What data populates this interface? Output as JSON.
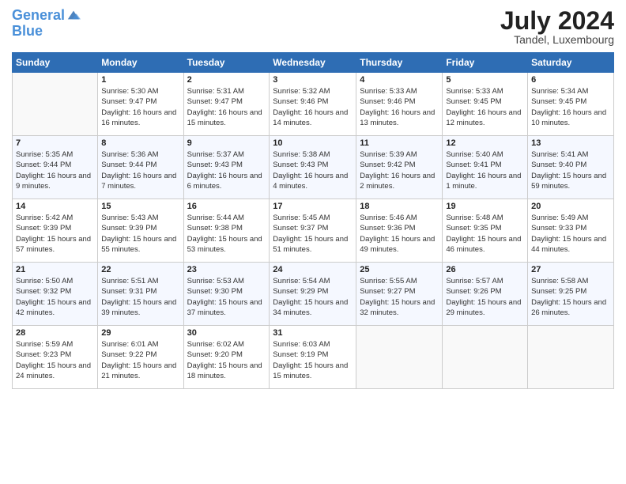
{
  "header": {
    "logo_line1": "General",
    "logo_line2": "Blue",
    "month": "July 2024",
    "location": "Tandel, Luxembourg"
  },
  "weekdays": [
    "Sunday",
    "Monday",
    "Tuesday",
    "Wednesday",
    "Thursday",
    "Friday",
    "Saturday"
  ],
  "weeks": [
    [
      {
        "day": "",
        "sunrise": "",
        "sunset": "",
        "daylight": ""
      },
      {
        "day": "1",
        "sunrise": "Sunrise: 5:30 AM",
        "sunset": "Sunset: 9:47 PM",
        "daylight": "Daylight: 16 hours and 16 minutes."
      },
      {
        "day": "2",
        "sunrise": "Sunrise: 5:31 AM",
        "sunset": "Sunset: 9:47 PM",
        "daylight": "Daylight: 16 hours and 15 minutes."
      },
      {
        "day": "3",
        "sunrise": "Sunrise: 5:32 AM",
        "sunset": "Sunset: 9:46 PM",
        "daylight": "Daylight: 16 hours and 14 minutes."
      },
      {
        "day": "4",
        "sunrise": "Sunrise: 5:33 AM",
        "sunset": "Sunset: 9:46 PM",
        "daylight": "Daylight: 16 hours and 13 minutes."
      },
      {
        "day": "5",
        "sunrise": "Sunrise: 5:33 AM",
        "sunset": "Sunset: 9:45 PM",
        "daylight": "Daylight: 16 hours and 12 minutes."
      },
      {
        "day": "6",
        "sunrise": "Sunrise: 5:34 AM",
        "sunset": "Sunset: 9:45 PM",
        "daylight": "Daylight: 16 hours and 10 minutes."
      }
    ],
    [
      {
        "day": "7",
        "sunrise": "Sunrise: 5:35 AM",
        "sunset": "Sunset: 9:44 PM",
        "daylight": "Daylight: 16 hours and 9 minutes."
      },
      {
        "day": "8",
        "sunrise": "Sunrise: 5:36 AM",
        "sunset": "Sunset: 9:44 PM",
        "daylight": "Daylight: 16 hours and 7 minutes."
      },
      {
        "day": "9",
        "sunrise": "Sunrise: 5:37 AM",
        "sunset": "Sunset: 9:43 PM",
        "daylight": "Daylight: 16 hours and 6 minutes."
      },
      {
        "day": "10",
        "sunrise": "Sunrise: 5:38 AM",
        "sunset": "Sunset: 9:43 PM",
        "daylight": "Daylight: 16 hours and 4 minutes."
      },
      {
        "day": "11",
        "sunrise": "Sunrise: 5:39 AM",
        "sunset": "Sunset: 9:42 PM",
        "daylight": "Daylight: 16 hours and 2 minutes."
      },
      {
        "day": "12",
        "sunrise": "Sunrise: 5:40 AM",
        "sunset": "Sunset: 9:41 PM",
        "daylight": "Daylight: 16 hours and 1 minute."
      },
      {
        "day": "13",
        "sunrise": "Sunrise: 5:41 AM",
        "sunset": "Sunset: 9:40 PM",
        "daylight": "Daylight: 15 hours and 59 minutes."
      }
    ],
    [
      {
        "day": "14",
        "sunrise": "Sunrise: 5:42 AM",
        "sunset": "Sunset: 9:39 PM",
        "daylight": "Daylight: 15 hours and 57 minutes."
      },
      {
        "day": "15",
        "sunrise": "Sunrise: 5:43 AM",
        "sunset": "Sunset: 9:39 PM",
        "daylight": "Daylight: 15 hours and 55 minutes."
      },
      {
        "day": "16",
        "sunrise": "Sunrise: 5:44 AM",
        "sunset": "Sunset: 9:38 PM",
        "daylight": "Daylight: 15 hours and 53 minutes."
      },
      {
        "day": "17",
        "sunrise": "Sunrise: 5:45 AM",
        "sunset": "Sunset: 9:37 PM",
        "daylight": "Daylight: 15 hours and 51 minutes."
      },
      {
        "day": "18",
        "sunrise": "Sunrise: 5:46 AM",
        "sunset": "Sunset: 9:36 PM",
        "daylight": "Daylight: 15 hours and 49 minutes."
      },
      {
        "day": "19",
        "sunrise": "Sunrise: 5:48 AM",
        "sunset": "Sunset: 9:35 PM",
        "daylight": "Daylight: 15 hours and 46 minutes."
      },
      {
        "day": "20",
        "sunrise": "Sunrise: 5:49 AM",
        "sunset": "Sunset: 9:33 PM",
        "daylight": "Daylight: 15 hours and 44 minutes."
      }
    ],
    [
      {
        "day": "21",
        "sunrise": "Sunrise: 5:50 AM",
        "sunset": "Sunset: 9:32 PM",
        "daylight": "Daylight: 15 hours and 42 minutes."
      },
      {
        "day": "22",
        "sunrise": "Sunrise: 5:51 AM",
        "sunset": "Sunset: 9:31 PM",
        "daylight": "Daylight: 15 hours and 39 minutes."
      },
      {
        "day": "23",
        "sunrise": "Sunrise: 5:53 AM",
        "sunset": "Sunset: 9:30 PM",
        "daylight": "Daylight: 15 hours and 37 minutes."
      },
      {
        "day": "24",
        "sunrise": "Sunrise: 5:54 AM",
        "sunset": "Sunset: 9:29 PM",
        "daylight": "Daylight: 15 hours and 34 minutes."
      },
      {
        "day": "25",
        "sunrise": "Sunrise: 5:55 AM",
        "sunset": "Sunset: 9:27 PM",
        "daylight": "Daylight: 15 hours and 32 minutes."
      },
      {
        "day": "26",
        "sunrise": "Sunrise: 5:57 AM",
        "sunset": "Sunset: 9:26 PM",
        "daylight": "Daylight: 15 hours and 29 minutes."
      },
      {
        "day": "27",
        "sunrise": "Sunrise: 5:58 AM",
        "sunset": "Sunset: 9:25 PM",
        "daylight": "Daylight: 15 hours and 26 minutes."
      }
    ],
    [
      {
        "day": "28",
        "sunrise": "Sunrise: 5:59 AM",
        "sunset": "Sunset: 9:23 PM",
        "daylight": "Daylight: 15 hours and 24 minutes."
      },
      {
        "day": "29",
        "sunrise": "Sunrise: 6:01 AM",
        "sunset": "Sunset: 9:22 PM",
        "daylight": "Daylight: 15 hours and 21 minutes."
      },
      {
        "day": "30",
        "sunrise": "Sunrise: 6:02 AM",
        "sunset": "Sunset: 9:20 PM",
        "daylight": "Daylight: 15 hours and 18 minutes."
      },
      {
        "day": "31",
        "sunrise": "Sunrise: 6:03 AM",
        "sunset": "Sunset: 9:19 PM",
        "daylight": "Daylight: 15 hours and 15 minutes."
      },
      {
        "day": "",
        "sunrise": "",
        "sunset": "",
        "daylight": ""
      },
      {
        "day": "",
        "sunrise": "",
        "sunset": "",
        "daylight": ""
      },
      {
        "day": "",
        "sunrise": "",
        "sunset": "",
        "daylight": ""
      }
    ]
  ]
}
